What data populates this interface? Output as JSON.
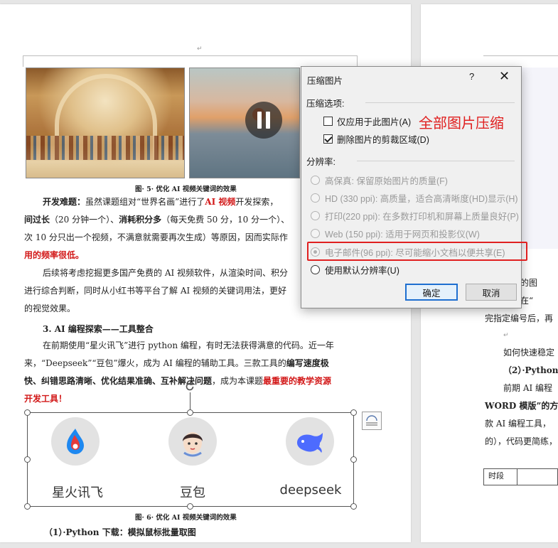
{
  "document": {
    "fig5_caption": "图· 5· 优化 AI 视频关键词的效果",
    "para1": {
      "l1_a": "开发难题：",
      "l1_b": "虽然课题组对“世界名画”进行了",
      "l1_c": "AI 视频",
      "l1_d": "开发探索，",
      "l2_a": "间过长",
      "l2_b": "（20 分钟一个）、",
      "l2_c": "消耗积分多",
      "l2_d": "（每天免费 50 分，10 分一个）、",
      "l3": "次 10 分只出一个视频，不满意就需要再次生成）等原因，因而实际作",
      "l4": "用的频率很低。"
    },
    "para2": {
      "l1": "后续将考虑挖掘更多国产免费的 AI 视频软件，从渲染时间、积分",
      "l2": "进行综合判断，同时从小红书等平台了解 AI 视频的关键词用法，更好",
      "l3": "的视觉效果。"
    },
    "heading3": "3. AI 编程探索——工具整合",
    "para3": {
      "l1": "在前期使用“星火讯飞”进行 python 编程，有时无法获得满意的代码。近一年",
      "l2_a": "来，“Deepseek”“豆包”爆火，成为 AI 编程的辅助工具。三款工具的",
      "l2_b": "编写速度极",
      "l3_a": "快、纠错思路清晰、优化结果准确、互补解决问题",
      "l3_b": "，成为本课题",
      "l3_c": "最重要的教学资源",
      "l4": "开发工具！"
    },
    "tools": [
      {
        "name": "星火讯飞",
        "icon": "xunfei-spark-icon"
      },
      {
        "name": "豆包",
        "icon": "doubao-icon"
      },
      {
        "name": "deepseek",
        "icon": "deepseek-whale-icon"
      }
    ],
    "fig6_caption": "图· 6· 优化 AI 视频关键词的效果",
    "heading_python": "（1）·Python 下载：模拟鼠标批量取图"
  },
  "right_page": {
    "lines": [
      "实用的图",
      "程序在“",
      "完指定编号后，再",
      "如何快速稳定",
      "（2）·Python",
      "前期 AI 编程",
      "WORD 模版”的方式",
      "款 AI 编程工具，",
      "的），代码更简练，"
    ],
    "table_cell": "时段"
  },
  "dialog": {
    "title": "压缩图片",
    "help": "?",
    "close": "✕",
    "compress_options_label": "压缩选项:",
    "only_this_picture": "仅应用于此图片(A)",
    "only_this_picture_checked": false,
    "delete_cropped": "删除图片的剪裁区域(D)",
    "delete_cropped_checked": true,
    "resolution_label": "分辨率:",
    "options": [
      {
        "label": "高保真: 保留原始图片的质量(F)",
        "enabled": false,
        "selected": false
      },
      {
        "label": "HD (330 ppi): 高质量，适合高清晰度(HD)显示(H)",
        "enabled": false,
        "selected": false
      },
      {
        "label": "打印(220 ppi): 在多数打印机和屏幕上质量良好(P)",
        "enabled": false,
        "selected": false
      },
      {
        "label": "Web (150 ppi): 适用于网页和投影仪(W)",
        "enabled": false,
        "selected": false
      },
      {
        "label": "电子邮件(96 ppi): 尽可能缩小文档以便共享(E)",
        "enabled": false,
        "selected": true
      },
      {
        "label": "使用默认分辨率(U)",
        "enabled": true,
        "selected": false
      }
    ],
    "ok": "确定",
    "cancel": "取消"
  },
  "annotation": "全部图片压缩",
  "colors": {
    "annotation_red": "#e02020",
    "emphasis_red": "#d21818",
    "primary_button_border": "#1e6fd0"
  }
}
